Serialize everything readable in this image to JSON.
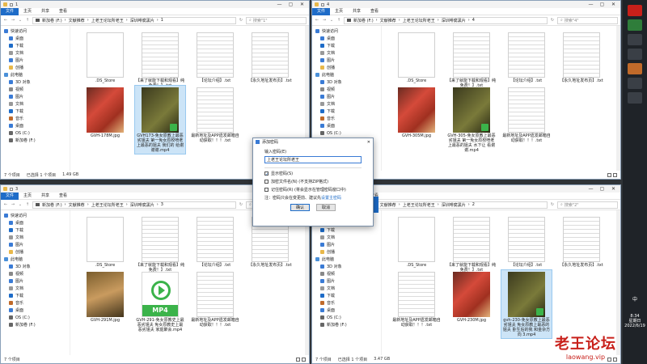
{
  "windows": [
    {
      "title": "1",
      "path": [
        "新加卷 (F:)",
        "文献推荐",
        "上老王论坛所老王",
        "深圳啡腐黑片",
        "1"
      ],
      "search": "搜索\"1\"",
      "status": {
        "count": "7 个项目",
        "selected": "已选择 1 个项目",
        "size": "1.49 GB"
      },
      "files": [
        {
          "n": ".DS_Store",
          "k": "doc"
        },
        {
          "n": "【来了就能下载和观看】纯免费！】.txt",
          "k": "lines"
        },
        {
          "n": "【论坛介绍】.txt",
          "k": "lines"
        },
        {
          "n": "【永久地址发布页】.txt",
          "k": "lines"
        },
        {
          "n": "GVH-178M.jpg",
          "k": "jpg"
        },
        {
          "n": "GVH173-免女原教上最恶劣姐夫 第一免女原校喷老上最恶的姐夫 我们的 给谢谢谢.mp4",
          "k": "vid"
        },
        {
          "n": "最新地址及APP遗发邮箱自动获取！！！.txt",
          "k": "lines"
        }
      ],
      "selected_index": 5
    },
    {
      "title": "4",
      "path": [
        "新加卷 (F:)",
        "文献推荐",
        "上老王论坛所老王",
        "深圳啡腐黑片",
        "4"
      ],
      "search": "搜索\"4\"",
      "status": {
        "count": "7 个项目",
        "selected": "",
        "size": ""
      },
      "files": [
        {
          "n": ".DS_Store",
          "k": "doc"
        },
        {
          "n": "【来了就能下载和观看】纯免费！】.txt",
          "k": "lines"
        },
        {
          "n": "【论坛介绍】.txt",
          "k": "lines"
        },
        {
          "n": "【永久地址发布页】.txt",
          "k": "lines"
        },
        {
          "n": "GVH-305M.jpg",
          "k": "jpg"
        },
        {
          "n": "GVH-305-免女原教上最恶劣姐夫 第一免女原校喷老上最恶的姐夫 水下让 看谢谢.mp4",
          "k": "vid"
        },
        {
          "n": "最新地址及APP遗发邮箱自动获取！！！.txt",
          "k": "lines"
        }
      ],
      "selected_index": -1
    },
    {
      "title": "3",
      "path": [
        "新加卷 (F:)",
        "文献推荐",
        "上老王论坛所老王",
        "深圳啡腐黑片",
        "3"
      ],
      "search": "搜索\"3\"",
      "status": {
        "count": "7 个项目",
        "selected": "",
        "size": ""
      },
      "files": [
        {
          "n": ".DS_Store",
          "k": "doc"
        },
        {
          "n": "【来了就能下载和观看】纯免费！】.txt",
          "k": "lines"
        },
        {
          "n": "【论坛介绍】.txt",
          "k": "lines"
        },
        {
          "n": "【永久地址发布页】.txt",
          "k": "lines"
        },
        {
          "n": "GVH-291M.jpg",
          "k": "jpg2"
        },
        {
          "n": "GVH-291-免女原教史上最恶劣姐夫 免女原教史上最恶劣姐夫 家庭聚会.mp4",
          "k": "mp4"
        },
        {
          "n": "最新地址及APP遗发邮箱自动获取！！！.txt",
          "k": "lines"
        }
      ],
      "selected_index": -1
    },
    {
      "title": "2",
      "path": [
        "新加卷 (F:)",
        "文献推荐",
        "上老王论坛所老王",
        "深圳啡腐黑片",
        "2"
      ],
      "search": "搜索\"2\"",
      "status": {
        "count": "7 个项目",
        "selected": "已选择 1 个项目",
        "size": "3.47 GB"
      },
      "files": [
        {
          "n": ".DS_Store",
          "k": "doc"
        },
        {
          "n": "【来了就能下载和观看】纯免费！】.txt",
          "k": "lines"
        },
        {
          "n": "【论坛介绍】.txt",
          "k": "lines"
        },
        {
          "n": "【永久地址发布页】.txt",
          "k": "lines"
        },
        {
          "n": "最新地址及APP遗发邮箱自动获取！！！.txt",
          "k": "lines"
        },
        {
          "n": "GVH-230M.jpg",
          "k": "jpg"
        },
        {
          "n": "gvh-230-免女原教上最恶劣姐夫 免女原教上最恶的姐夫 卧生后的我 和金杂方向 3.mp4",
          "k": "vid"
        }
      ],
      "selected_index": 6
    }
  ],
  "ribbon": {
    "file": "文件",
    "home": "主页",
    "share": "共享",
    "view": "查看"
  },
  "sidebar": [
    "快速访问",
    "桌面",
    "下载",
    "文档",
    "图片",
    "创播",
    "此电脑",
    "3D 对象",
    "视频",
    "图片",
    "文档",
    "下载",
    "音乐",
    "桌面",
    "OS (C:)",
    "新加卷 (F:)"
  ],
  "dialog": {
    "title": "添加密码",
    "label": "输入密码(E)",
    "value": "上老王论坛所老王",
    "c1": "显示密码(S)",
    "c2": "加密文件名(N) (不支持ZIP格式)",
    "c3": "记住密码(R) (将会显示在管理密码窗口中)",
    "note": "注：密码只会在变更前、建议先",
    "link": "设置主密码",
    "ok": "确认",
    "cancel": "取消"
  },
  "taskbar": {
    "ime": "中",
    "time": "8:34",
    "weekday": "星期日",
    "date": "2022/6/19"
  },
  "watermark": {
    "top": "老王论坛",
    "bottom": "laowang.vip"
  }
}
